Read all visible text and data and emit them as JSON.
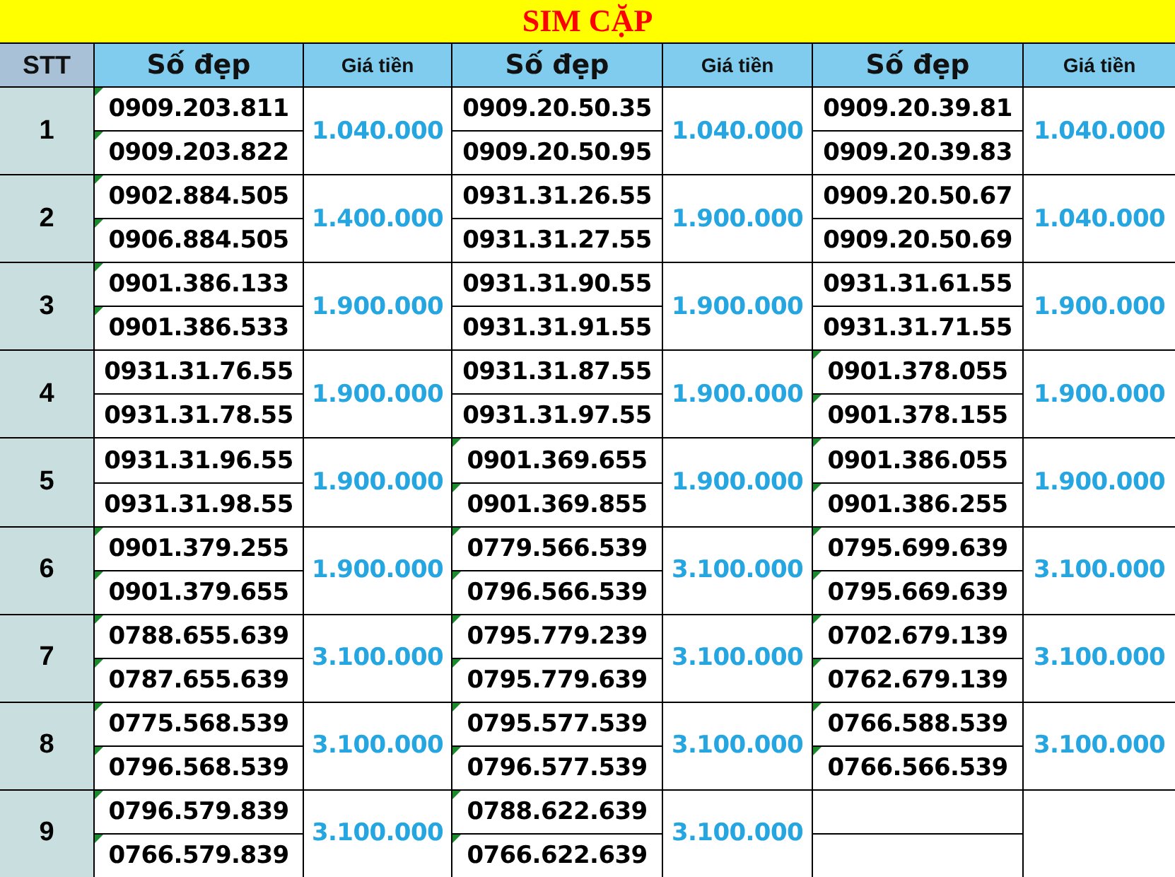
{
  "title": "SIM CẶP",
  "columns": [
    {
      "label": "STT",
      "kind": "index"
    },
    {
      "label": "Số đẹp",
      "kind": "number"
    },
    {
      "label": "Giá tiền",
      "kind": "price"
    },
    {
      "label": "Số đẹp",
      "kind": "number"
    },
    {
      "label": "Giá tiền",
      "kind": "price"
    },
    {
      "label": "Số đẹp",
      "kind": "number"
    },
    {
      "label": "Giá tiền",
      "kind": "price"
    }
  ],
  "rows": [
    {
      "stt": "1",
      "groups": [
        {
          "numbers": [
            {
              "text": "0909.203.811",
              "flagged": true
            },
            {
              "text": "0909.203.822",
              "flagged": true
            }
          ],
          "price": "1.040.000"
        },
        {
          "numbers": [
            {
              "text": "0909.20.50.35",
              "flagged": false
            },
            {
              "text": "0909.20.50.95",
              "flagged": false
            }
          ],
          "price": "1.040.000"
        },
        {
          "numbers": [
            {
              "text": "0909.20.39.81",
              "flagged": false
            },
            {
              "text": "0909.20.39.83",
              "flagged": false
            }
          ],
          "price": "1.040.000"
        }
      ]
    },
    {
      "stt": "2",
      "groups": [
        {
          "numbers": [
            {
              "text": "0902.884.505",
              "flagged": true
            },
            {
              "text": "0906.884.505",
              "flagged": true
            }
          ],
          "price": "1.400.000"
        },
        {
          "numbers": [
            {
              "text": "0931.31.26.55",
              "flagged": false
            },
            {
              "text": "0931.31.27.55",
              "flagged": false
            }
          ],
          "price": "1.900.000"
        },
        {
          "numbers": [
            {
              "text": "0909.20.50.67",
              "flagged": false
            },
            {
              "text": "0909.20.50.69",
              "flagged": false
            }
          ],
          "price": "1.040.000"
        }
      ]
    },
    {
      "stt": "3",
      "groups": [
        {
          "numbers": [
            {
              "text": "0901.386.133",
              "flagged": true
            },
            {
              "text": "0901.386.533",
              "flagged": true
            }
          ],
          "price": "1.900.000"
        },
        {
          "numbers": [
            {
              "text": "0931.31.90.55",
              "flagged": false
            },
            {
              "text": "0931.31.91.55",
              "flagged": false
            }
          ],
          "price": "1.900.000"
        },
        {
          "numbers": [
            {
              "text": "0931.31.61.55",
              "flagged": false
            },
            {
              "text": "0931.31.71.55",
              "flagged": false
            }
          ],
          "price": "1.900.000"
        }
      ]
    },
    {
      "stt": "4",
      "groups": [
        {
          "numbers": [
            {
              "text": "0931.31.76.55",
              "flagged": false
            },
            {
              "text": "0931.31.78.55",
              "flagged": false
            }
          ],
          "price": "1.900.000"
        },
        {
          "numbers": [
            {
              "text": "0931.31.87.55",
              "flagged": false
            },
            {
              "text": "0931.31.97.55",
              "flagged": false
            }
          ],
          "price": "1.900.000"
        },
        {
          "numbers": [
            {
              "text": "0901.378.055",
              "flagged": true
            },
            {
              "text": "0901.378.155",
              "flagged": true
            }
          ],
          "price": "1.900.000"
        }
      ]
    },
    {
      "stt": "5",
      "groups": [
        {
          "numbers": [
            {
              "text": "0931.31.96.55",
              "flagged": false
            },
            {
              "text": "0931.31.98.55",
              "flagged": false
            }
          ],
          "price": "1.900.000"
        },
        {
          "numbers": [
            {
              "text": "0901.369.655",
              "flagged": true
            },
            {
              "text": "0901.369.855",
              "flagged": true
            }
          ],
          "price": "1.900.000"
        },
        {
          "numbers": [
            {
              "text": "0901.386.055",
              "flagged": true
            },
            {
              "text": "0901.386.255",
              "flagged": true
            }
          ],
          "price": "1.900.000"
        }
      ]
    },
    {
      "stt": "6",
      "groups": [
        {
          "numbers": [
            {
              "text": "0901.379.255",
              "flagged": true
            },
            {
              "text": "0901.379.655",
              "flagged": true
            }
          ],
          "price": "1.900.000"
        },
        {
          "numbers": [
            {
              "text": "0779.566.539",
              "flagged": true
            },
            {
              "text": "0796.566.539",
              "flagged": true
            }
          ],
          "price": "3.100.000"
        },
        {
          "numbers": [
            {
              "text": "0795.699.639",
              "flagged": true
            },
            {
              "text": "0795.669.639",
              "flagged": true
            }
          ],
          "price": "3.100.000"
        }
      ]
    },
    {
      "stt": "7",
      "groups": [
        {
          "numbers": [
            {
              "text": "0788.655.639",
              "flagged": true
            },
            {
              "text": "0787.655.639",
              "flagged": true
            }
          ],
          "price": "3.100.000"
        },
        {
          "numbers": [
            {
              "text": "0795.779.239",
              "flagged": true
            },
            {
              "text": "0795.779.639",
              "flagged": true
            }
          ],
          "price": "3.100.000"
        },
        {
          "numbers": [
            {
              "text": "0702.679.139",
              "flagged": true
            },
            {
              "text": "0762.679.139",
              "flagged": true
            }
          ],
          "price": "3.100.000"
        }
      ]
    },
    {
      "stt": "8",
      "groups": [
        {
          "numbers": [
            {
              "text": "0775.568.539",
              "flagged": true
            },
            {
              "text": "0796.568.539",
              "flagged": true
            }
          ],
          "price": "3.100.000"
        },
        {
          "numbers": [
            {
              "text": "0795.577.539",
              "flagged": true
            },
            {
              "text": "0796.577.539",
              "flagged": true
            }
          ],
          "price": "3.100.000"
        },
        {
          "numbers": [
            {
              "text": "0766.588.539",
              "flagged": true
            },
            {
              "text": "0766.566.539",
              "flagged": true
            }
          ],
          "price": "3.100.000"
        }
      ]
    },
    {
      "stt": "9",
      "groups": [
        {
          "numbers": [
            {
              "text": "0796.579.839",
              "flagged": true
            },
            {
              "text": "0766.579.839",
              "flagged": true
            }
          ],
          "price": "3.100.000"
        },
        {
          "numbers": [
            {
              "text": "0788.622.639",
              "flagged": true
            },
            {
              "text": "0766.622.639",
              "flagged": true
            }
          ],
          "price": "3.100.000"
        }
      ]
    }
  ]
}
